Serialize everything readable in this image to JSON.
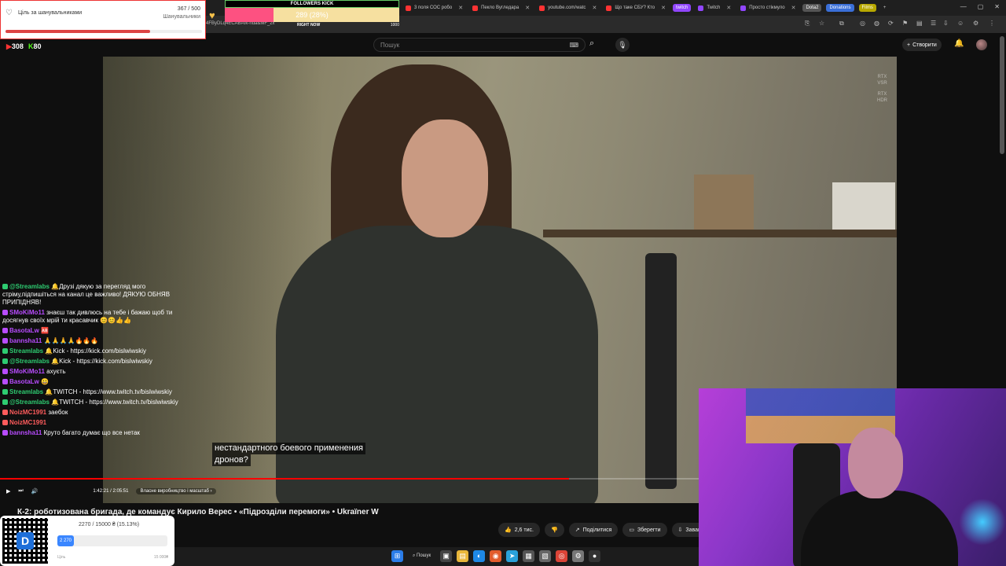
{
  "browser": {
    "tabs": [
      {
        "label": "",
        "color": "#6c6"
      },
      {
        "label": "3 поля СОС робо",
        "color": "#f33"
      },
      {
        "label": "Пекло Вугледара",
        "color": "#f33"
      },
      {
        "label": "youtube.com/watc",
        "color": "#f33"
      },
      {
        "label": "Що таке СБУ? Кто",
        "color": "#f33"
      },
      {
        "label": "twitch",
        "color": "#9146ff"
      },
      {
        "label": "Twitch",
        "color": "#9146ff"
      },
      {
        "label": "Просто стікмуло",
        "color": "#9146ff"
      }
    ],
    "pills": [
      {
        "label": "Dota2",
        "color": "#555"
      },
      {
        "label": "Donations",
        "color": "#3a6fd8"
      },
      {
        "label": "Films",
        "color": "#c8b800"
      }
    ],
    "url": "4FByDLq4ECABAIk-nda&MF_zx"
  },
  "youtube": {
    "search_placeholder": "Пошук",
    "create_label": "Створити",
    "video_title": "К-2: роботизована бригада, де командує Кирило Верес • «Підрозділи перемоги» • Ukraïner W",
    "subtitle_line1": "нестандартного боевого применения",
    "subtitle_line2": "дронов?",
    "time": "1:42:21 / 2:05:51",
    "chapter": "Власне виробництво і масштаб",
    "progress": 0.8134,
    "legend": [
      "RTX",
      "VSR",
      "RTX",
      "HDR"
    ],
    "like_count": "2,6 тис.",
    "share_label": "Поділитися",
    "save_label": "Зберегти",
    "download_label": "Завант"
  },
  "overlays": {
    "goal_title": "Ціль за шанувальниками",
    "goal_count": "367 / 500",
    "goal_label": "Шанувальники",
    "goal_progress": 0.734,
    "followers_header": "FOLLOWERS KICK",
    "followers_value": "289 (28%)",
    "followers_progress": 0.28,
    "followers_right": "RIGHT NOW",
    "followers_max": "1000",
    "viewers_a": "308",
    "viewers_b": "80",
    "donate_text": "2270 / 15000 ₴ (15.13%)",
    "donate_bar_label": "2 270",
    "donate_progress": 0.1513,
    "donate_left": "Ціль",
    "donate_right": "15 000₴"
  },
  "chat": [
    {
      "user": "@Streamlabs",
      "color": "#2ecc71",
      "text": "🔔Друзі дякую за перегляд мого стріму,підпишіться на канал це важливо! ДЯКУЮ ОБНЯВ ПРИПІДНЯВ!"
    },
    {
      "user": "SMoKiMo11",
      "color": "#b84cff",
      "text": "знаєш так дивлюсь на тебе і бажаю щоб ти досягнув своїх мрій ти красавчик 😊😊👍👍"
    },
    {
      "user": "BasotaLw",
      "color": "#b84cff",
      "text": "🆎"
    },
    {
      "user": "bannsha11",
      "color": "#b84cff",
      "text": "🙏🙏🙏🙏🔥🔥🔥"
    },
    {
      "user": "Streamlabs",
      "color": "#2ecc71",
      "text": "🔔Kick - https://kick.com/bislwiwskiy"
    },
    {
      "user": "@Streamlabs",
      "color": "#2ecc71",
      "text": "🔔Kick - https://kick.com/bislwiwskiy"
    },
    {
      "user": "SMoKiMo11",
      "color": "#b84cff",
      "text": "ахуєть"
    },
    {
      "user": "BasotaLw",
      "color": "#b84cff",
      "text": "😀"
    },
    {
      "user": "Streamlabs",
      "color": "#2ecc71",
      "text": "🔔TWITCH - https://www.twitch.tv/bislwiwskiy"
    },
    {
      "user": "@Streamlabs",
      "color": "#2ecc71",
      "text": "🔔TWITCH - https://www.twitch.tv/bislwiwskiy"
    },
    {
      "user": "NoizMC1991",
      "color": "#ff5c5c",
      "text": "заебок"
    },
    {
      "user": "NoizMC1991",
      "color": "#ff5c5c",
      "text": ""
    },
    {
      "user": "bannsha11",
      "color": "#b84cff",
      "text": "Круто багато думає що все нетак"
    }
  ],
  "taskbar": {
    "search_label": "Пошук"
  }
}
